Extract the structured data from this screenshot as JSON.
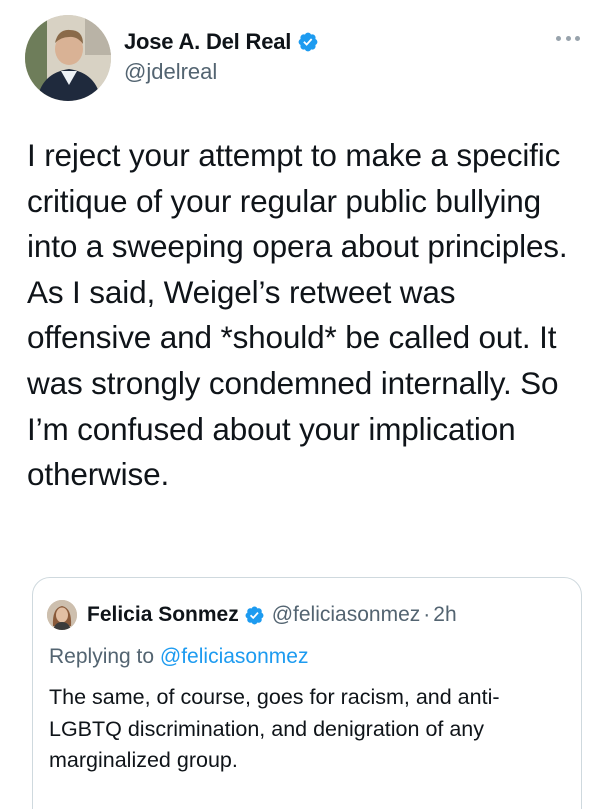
{
  "tweet": {
    "author": {
      "display_name": "Jose A. Del Real",
      "handle": "@jdelreal",
      "verified": true,
      "avatar_icon": "profile-photo"
    },
    "more_icon": "more-horizontal-icon",
    "text": "I reject your attempt to make a specific critique of your regular public bullying into a sweeping opera about principles. As I said, Weigel’s retweet was offensive and *should* be called out. It was strongly condemned internally. So I’m confused about your implication otherwise."
  },
  "quoted_tweet": {
    "author": {
      "display_name": "Felicia Sonmez",
      "handle": "@feliciasonmez",
      "separator": "·",
      "time": "2h",
      "verified": true,
      "avatar_icon": "profile-photo"
    },
    "replying_to": {
      "prefix": "Replying to",
      "mention": "@feliciasonmez"
    },
    "text": "The same, of course, goes for racism, and anti-LGBTQ discrimination, and denigration of any marginalized group."
  },
  "colors": {
    "text": "#0f1419",
    "secondary": "#536471",
    "link": "#1d9bf0",
    "verified": "#1d9bf0",
    "border": "#cfd9de"
  }
}
